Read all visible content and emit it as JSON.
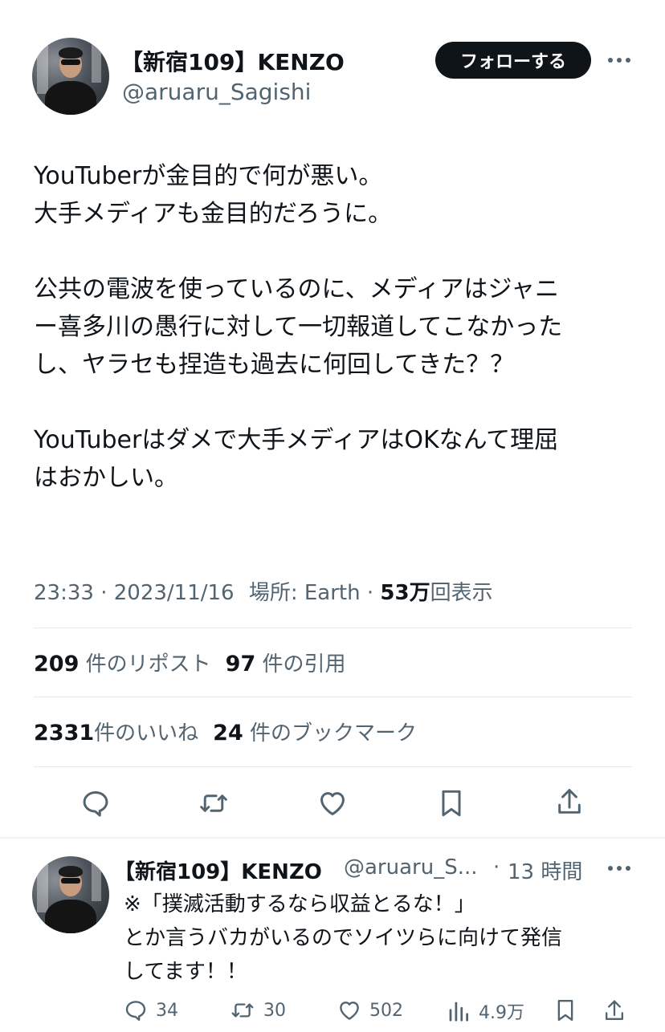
{
  "author": {
    "name": "【新宿109】KENZO",
    "handle": "@aruaru_Sagishi"
  },
  "follow_button": "フォローする",
  "tweet": {
    "lines": [
      "YouTuberが金目的で何が悪い。",
      "大手メディアも金目的だろうに。",
      "",
      "公共の電波を使っているのに、メディアはジャニ",
      "ー喜多川の愚行に対して一切報道してこなかった",
      "し、ヤラセも捏造も過去に何回してきた？？",
      "",
      "YouTuberはダメで大手メディアはOKなんて理屈",
      "はおかしい。"
    ]
  },
  "meta": {
    "time": "23:33",
    "date": "2023/11/16",
    "location": "場所: Earth",
    "views_count": "53万",
    "views_label": "回表示"
  },
  "stats": {
    "reposts_count": "209",
    "reposts_label": "件のリポスト",
    "quotes_count": "97",
    "quotes_label": "件の引用",
    "likes_count": "2331",
    "likes_label": "件のいいね",
    "bookmarks_count": "24",
    "bookmarks_label": "件のブックマーク"
  },
  "icons": {
    "reply": "reply-icon",
    "retweet": "retweet-icon",
    "like": "heart-icon",
    "bookmark": "bookmark-icon",
    "share": "share-icon",
    "views": "views-icon",
    "more": "more-icon"
  },
  "reply": {
    "name": "【新宿109】KENZO",
    "handle": "@aruaru_S...",
    "time": "13 時間",
    "lines": [
      "※「撲滅活動するなら収益とるな！」",
      "とか言うバカがいるのでソイツらに向けて発信",
      "してます！！"
    ],
    "replies": "34",
    "retweets": "30",
    "likes": "502",
    "views": "4.9万"
  },
  "colors": {
    "text": "#0f1419",
    "secondary": "#536471",
    "divider": "#eff3f4",
    "button_bg": "#0f1419"
  }
}
